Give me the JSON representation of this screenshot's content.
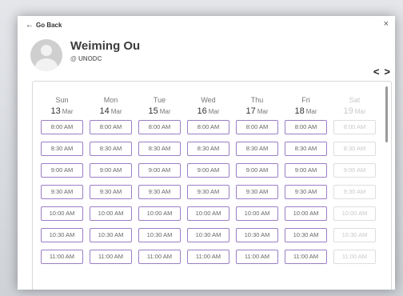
{
  "header": {
    "go_back_label": "Go Back",
    "close_label": "×"
  },
  "user": {
    "name": "Weiming Ou",
    "org": "@ UNODC"
  },
  "nav": {
    "prev_label": "<",
    "next_label": ">"
  },
  "colors": {
    "slot_border": "#9b7fc6",
    "disabled": "#c9c9c9"
  },
  "calendar": {
    "days": [
      {
        "name": "Sun",
        "date": "13",
        "month": "Mar",
        "disabled": false
      },
      {
        "name": "Mon",
        "date": "14",
        "month": "Mar",
        "disabled": false
      },
      {
        "name": "Tue",
        "date": "15",
        "month": "Mar",
        "disabled": false
      },
      {
        "name": "Wed",
        "date": "16",
        "month": "Mar",
        "disabled": false
      },
      {
        "name": "Thu",
        "date": "17",
        "month": "Mar",
        "disabled": false
      },
      {
        "name": "Fri",
        "date": "18",
        "month": "Mar",
        "disabled": false
      },
      {
        "name": "Sat",
        "date": "19",
        "month": "Mar",
        "disabled": true
      }
    ],
    "times": [
      "8:00 AM",
      "8:30 AM",
      "9:00 AM",
      "9:30 AM",
      "10:00 AM",
      "10:30 AM",
      "11:00 AM"
    ]
  }
}
